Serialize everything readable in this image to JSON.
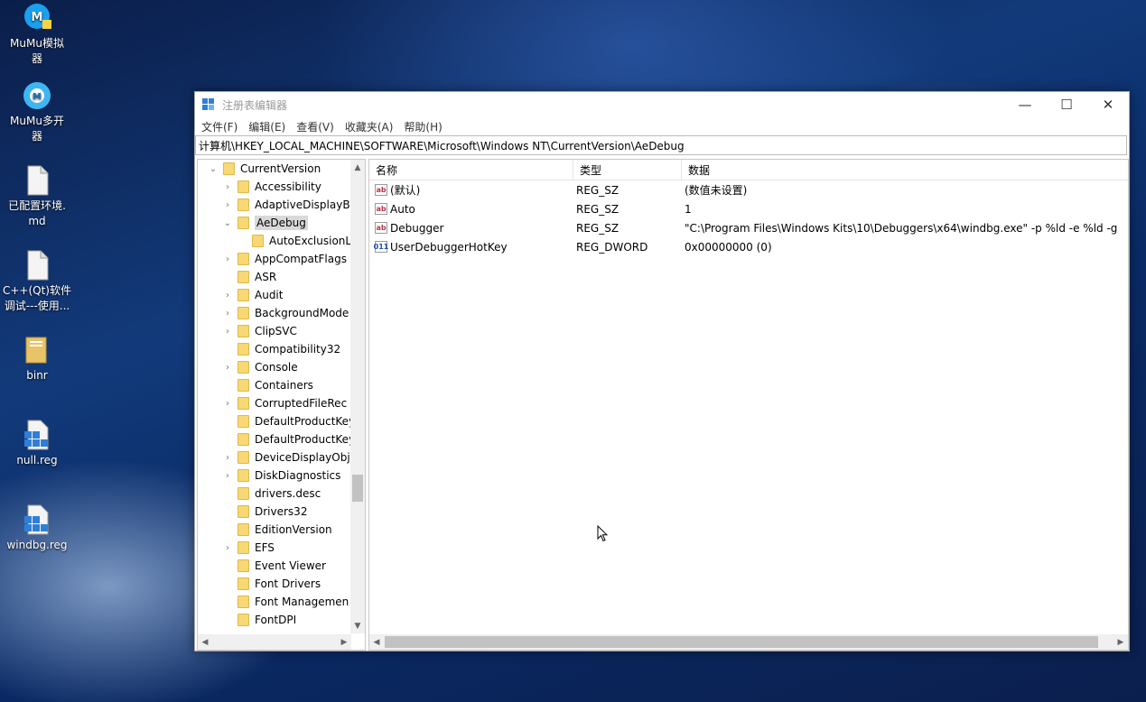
{
  "desktop": {
    "icons": [
      {
        "label": "MuMu模拟\n器",
        "icon": "mumu-app-icon"
      },
      {
        "label": "MuMu多开\n器",
        "icon": "mumu-multi-icon"
      },
      {
        "label": "已配置环境.\nmd",
        "icon": "file-icon"
      },
      {
        "label": "C++(Qt)软件\n调试---使用...",
        "icon": "file-icon"
      },
      {
        "label": "binr",
        "icon": "folder-icon"
      },
      {
        "label": "null.reg",
        "icon": "registry-file-icon"
      },
      {
        "label": "windbg.reg",
        "icon": "registry-file-icon"
      }
    ]
  },
  "window": {
    "title": "注册表编辑器",
    "controls": {
      "minimize": "—",
      "maximize": "☐",
      "close": "✕"
    },
    "menu": [
      "文件(F)",
      "编辑(E)",
      "查看(V)",
      "收藏夹(A)",
      "帮助(H)"
    ],
    "address": "计算机\\HKEY_LOCAL_MACHINE\\SOFTWARE\\Microsoft\\Windows NT\\CurrentVersion\\AeDebug"
  },
  "tree": {
    "items": [
      {
        "label": "CurrentVersion",
        "level": 0,
        "arrow": "⌄",
        "selected": false
      },
      {
        "label": "Accessibility",
        "level": 1,
        "arrow": "›",
        "selected": false
      },
      {
        "label": "AdaptiveDisplayB",
        "level": 1,
        "arrow": "›",
        "selected": false
      },
      {
        "label": "AeDebug",
        "level": 1,
        "arrow": "⌄",
        "selected": true
      },
      {
        "label": "AutoExclusionL",
        "level": 2,
        "arrow": "",
        "selected": false
      },
      {
        "label": "AppCompatFlags",
        "level": 1,
        "arrow": "›",
        "selected": false
      },
      {
        "label": "ASR",
        "level": 1,
        "arrow": "",
        "selected": false
      },
      {
        "label": "Audit",
        "level": 1,
        "arrow": "›",
        "selected": false
      },
      {
        "label": "BackgroundMode",
        "level": 1,
        "arrow": "›",
        "selected": false
      },
      {
        "label": "ClipSVC",
        "level": 1,
        "arrow": "›",
        "selected": false
      },
      {
        "label": "Compatibility32",
        "level": 1,
        "arrow": "",
        "selected": false
      },
      {
        "label": "Console",
        "level": 1,
        "arrow": "›",
        "selected": false
      },
      {
        "label": "Containers",
        "level": 1,
        "arrow": "",
        "selected": false
      },
      {
        "label": "CorruptedFileRec",
        "level": 1,
        "arrow": "›",
        "selected": false
      },
      {
        "label": "DefaultProductKey",
        "level": 1,
        "arrow": "",
        "selected": false
      },
      {
        "label": "DefaultProductKey",
        "level": 1,
        "arrow": "",
        "selected": false
      },
      {
        "label": "DeviceDisplayObj",
        "level": 1,
        "arrow": "›",
        "selected": false
      },
      {
        "label": "DiskDiagnostics",
        "level": 1,
        "arrow": "›",
        "selected": false
      },
      {
        "label": "drivers.desc",
        "level": 1,
        "arrow": "",
        "selected": false
      },
      {
        "label": "Drivers32",
        "level": 1,
        "arrow": "",
        "selected": false
      },
      {
        "label": "EditionVersion",
        "level": 1,
        "arrow": "",
        "selected": false
      },
      {
        "label": "EFS",
        "level": 1,
        "arrow": "›",
        "selected": false
      },
      {
        "label": "Event Viewer",
        "level": 1,
        "arrow": "",
        "selected": false
      },
      {
        "label": "Font Drivers",
        "level": 1,
        "arrow": "",
        "selected": false
      },
      {
        "label": "Font Managemen",
        "level": 1,
        "arrow": "",
        "selected": false
      },
      {
        "label": "FontDPI",
        "level": 1,
        "arrow": "",
        "selected": false
      }
    ]
  },
  "list": {
    "headers": {
      "name": "名称",
      "type": "类型",
      "data": "数据"
    },
    "rows": [
      {
        "icon": "ab",
        "name": "(默认)",
        "type": "REG_SZ",
        "data": "(数值未设置)"
      },
      {
        "icon": "ab",
        "name": "Auto",
        "type": "REG_SZ",
        "data": "1"
      },
      {
        "icon": "ab",
        "name": "Debugger",
        "type": "REG_SZ",
        "data": "\"C:\\Program Files\\Windows Kits\\10\\Debuggers\\x64\\windbg.exe\" -p %ld -e %ld -g"
      },
      {
        "icon": "011",
        "name": "UserDebuggerHotKey",
        "type": "REG_DWORD",
        "data": "0x00000000 (0)"
      }
    ]
  }
}
